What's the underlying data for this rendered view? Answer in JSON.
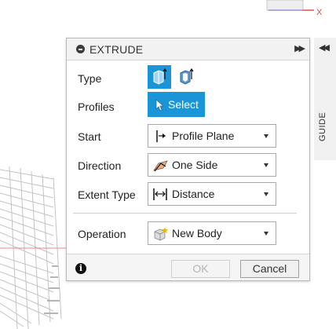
{
  "dialog": {
    "title": "EXTRUDE",
    "rows": {
      "type": {
        "label": "Type"
      },
      "profiles": {
        "label": "Profiles",
        "button_label": "Select"
      },
      "start": {
        "label": "Start",
        "value": "Profile Plane",
        "icon": "profile-plane-icon"
      },
      "direction": {
        "label": "Direction",
        "value": "One Side",
        "icon": "one-side-icon"
      },
      "extent_type": {
        "label": "Extent Type",
        "value": "Distance",
        "icon": "distance-icon"
      },
      "operation": {
        "label": "Operation",
        "value": "New Body",
        "icon": "new-body-icon"
      }
    },
    "buttons": {
      "ok": "OK",
      "cancel": "Cancel"
    }
  },
  "side_panel": {
    "label": "GUIDE"
  },
  "axis_label": "X",
  "colors": {
    "accent": "#1a96d8",
    "axis_red": "#e64a4a"
  }
}
